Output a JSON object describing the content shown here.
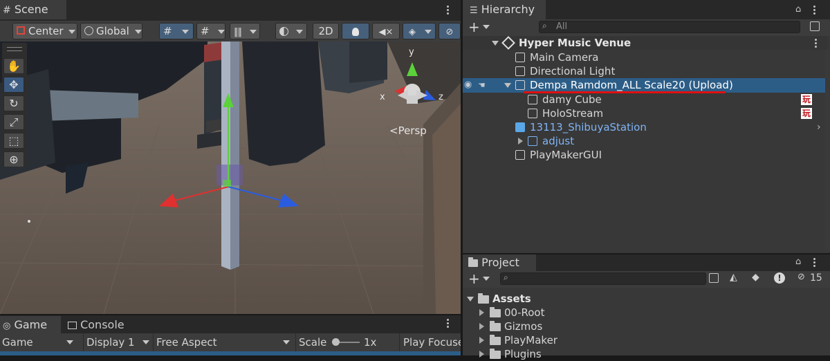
{
  "scene": {
    "tab_label": "Scene",
    "toolbar": {
      "pivot": "Center",
      "space": "Global",
      "mode_2d": "2D"
    },
    "persp_label": "<Persp",
    "gizmo_axes": {
      "y": "y",
      "x": "x",
      "z": "z"
    }
  },
  "game": {
    "tabs": [
      "Game",
      "Console"
    ],
    "display_dropdown": "Game",
    "display_select": "Display 1",
    "aspect": "Free Aspect",
    "scale_label": "Scale",
    "scale_value": "1x",
    "play_focused": "Play Focuse"
  },
  "hierarchy": {
    "tab_label": "Hierarchy",
    "search_placeholder": "All",
    "scene_name": "Hyper Music Venue",
    "items": [
      {
        "label": "Main Camera"
      },
      {
        "label": "Directional Light"
      },
      {
        "label": "Dempa Ramdom_ALL Scale20 (Upload)"
      },
      {
        "label": "damy Cube",
        "badge": "玩"
      },
      {
        "label": "HoloStream",
        "badge": "玩"
      },
      {
        "label": "13113_ShibuyaStation"
      },
      {
        "label": "adjust"
      },
      {
        "label": "PlayMakerGUI"
      }
    ],
    "colors": {
      "selected_bg": "#2c5d87",
      "prefab_text": "#7fb4f5",
      "underline": "#e01010"
    }
  },
  "project": {
    "tab_label": "Project",
    "hidden_count": "15",
    "root_folder": "Assets",
    "folders": [
      "00-Root",
      "Gizmos",
      "PlayMaker",
      "Plugins"
    ]
  }
}
